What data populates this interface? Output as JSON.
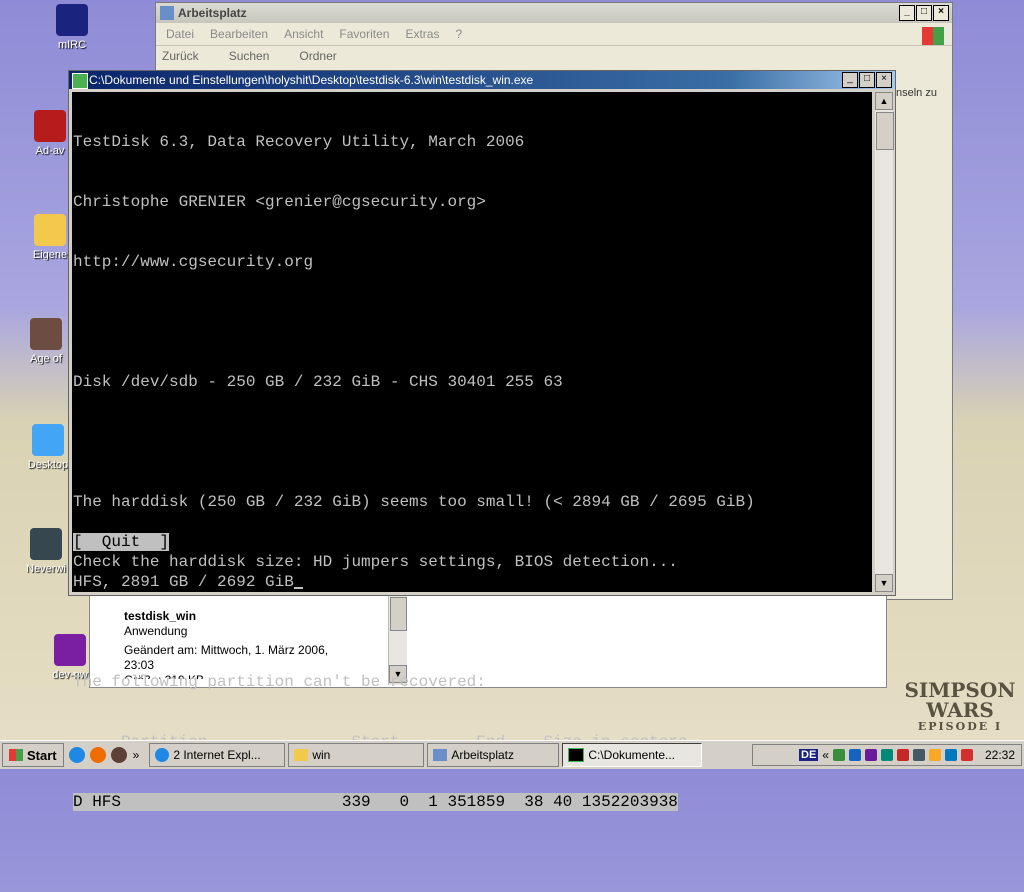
{
  "desktop": {
    "icons": [
      {
        "label": "mIRC"
      },
      {
        "label": "Ad-av"
      },
      {
        "label": "Eigene"
      },
      {
        "label": "Age of"
      },
      {
        "label": "Desktop"
      },
      {
        "label": "Neverwi"
      },
      {
        "label": "dev-nw"
      }
    ],
    "wallpaper_logo": [
      "SIMPSON",
      "WARS",
      "EPISODE I"
    ]
  },
  "explorer": {
    "title": "Arbeitsplatz",
    "menu": [
      "Datei",
      "Bearbeiten",
      "Ansicht",
      "Favoriten",
      "Extras",
      "?"
    ],
    "toolbar": [
      "Zurück",
      "Suchen",
      "Ordner"
    ],
    "side_fragment": "nseln zu"
  },
  "details_panel": {
    "name": "testdisk_win",
    "type": "Anwendung",
    "modified_line1": "Geändert am: Mittwoch, 1. März 2006,",
    "modified_line2": "23:03",
    "size_partial": "Größe: 219 KB"
  },
  "console": {
    "title": "C:\\Dokumente und Einstellungen\\holyshit\\Desktop\\testdisk-6.3\\win\\testdisk_win.exe",
    "lines": [
      "TestDisk 6.3, Data Recovery Utility, March 2006",
      "Christophe GRENIER <grenier@cgsecurity.org>",
      "http://www.cgsecurity.org",
      "",
      "Disk /dev/sdb - 250 GB / 232 GiB - CHS 30401 255 63",
      "",
      "The harddisk (250 GB / 232 GiB) seems too small! (< 2894 GB / 2695 GiB)",
      "Check the harddisk size: HD jumpers settings, BIOS detection...",
      "",
      "The following partition can't be recovered:",
      "     Partition               Start        End    Size in sectors"
    ],
    "partition_row": "D HFS                       339   0  1 351859  38 40 1352203938",
    "quit_label": "[  Quit  ]",
    "status_line": "HFS, 2891 GB / 2692 GiB"
  },
  "taskbar": {
    "start_label": "Start",
    "tasks": [
      {
        "label": "2 Internet Expl..."
      },
      {
        "label": "win"
      },
      {
        "label": "Arbeitsplatz"
      },
      {
        "label": "C:\\Dokumente..."
      }
    ],
    "clock": "22:32",
    "lang": "DE"
  }
}
